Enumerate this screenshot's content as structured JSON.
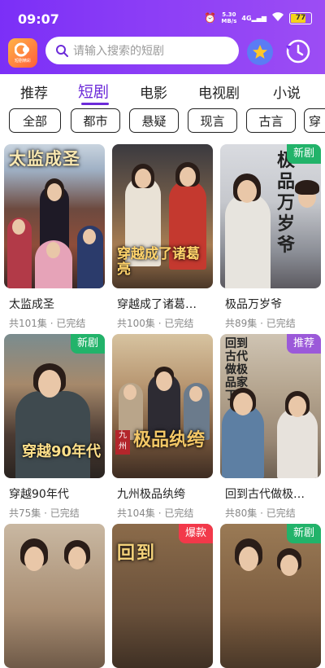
{
  "status_bar": {
    "time": "09:07",
    "network_speed": "5.30",
    "network_unit": "MB/s",
    "signal": "4G",
    "battery": "77"
  },
  "header": {
    "logo_text": "短剧精彩",
    "search_placeholder": "请输入搜索的短剧"
  },
  "tabs": [
    "推荐",
    "短剧",
    "电影",
    "电视剧",
    "小说"
  ],
  "active_tab": "短剧",
  "chips": [
    "全部",
    "都市",
    "悬疑",
    "现言",
    "古言",
    "穿"
  ],
  "cards": [
    {
      "title": "太监成圣",
      "info": "共101集 · 已完结",
      "poster_text": "太监成圣",
      "badge": ""
    },
    {
      "title": "穿越成了诸葛…",
      "info": "共100集 · 已完结",
      "poster_text": "穿越成了诸葛亮",
      "badge": ""
    },
    {
      "title": "极品万岁爷",
      "info": "共89集 · 已完结",
      "poster_text": "极品万岁爷",
      "badge": "新剧"
    },
    {
      "title": "穿越90年代",
      "info": "共75集 · 已完结",
      "poster_text": "穿越90年代",
      "badge": "新剧"
    },
    {
      "title": "九州极品纨绔",
      "info": "共104集 · 已完结",
      "poster_text": "极品纨绔",
      "badge": ""
    },
    {
      "title": "回到古代做极…",
      "info": "共80集 · 已完结",
      "poster_text": "回到古代做极品家丁",
      "badge": "推荐"
    },
    {
      "title": "",
      "info": "",
      "poster_text": "",
      "badge": ""
    },
    {
      "title": "",
      "info": "",
      "poster_text": "回到",
      "badge": "爆款"
    },
    {
      "title": "",
      "info": "",
      "poster_text": "",
      "badge": "新剧"
    }
  ],
  "colors": {
    "accent": "#6c2bd9",
    "header": "#8a3cf6",
    "badge_green": "#22b36a",
    "badge_purple": "#9b59d9",
    "badge_red": "#f2394a"
  }
}
